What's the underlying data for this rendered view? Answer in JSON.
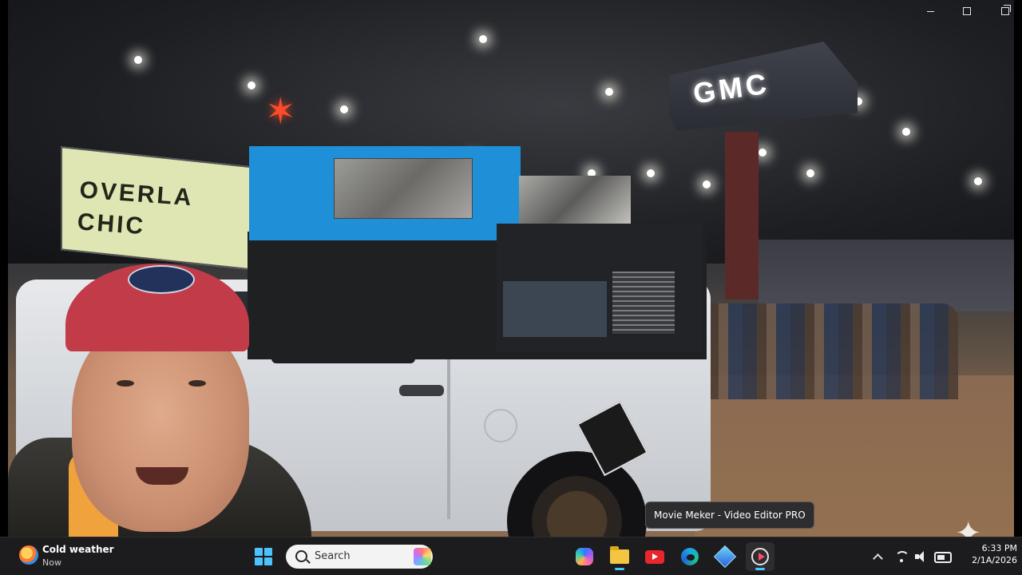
{
  "video": {
    "banner_text": "OVERLA\nCHIC",
    "sign_text": "GMC"
  },
  "tooltip": {
    "text": "Movie Meker - Video Editor PRO"
  },
  "taskbar": {
    "weather_title": "Cold weather",
    "weather_sub": "Now",
    "search_placeholder": "Search",
    "apps": [
      {
        "name": "copilot-icon"
      },
      {
        "name": "folder-icon"
      },
      {
        "name": "youtube-icon"
      },
      {
        "name": "edge-icon"
      },
      {
        "name": "diamond-icon"
      },
      {
        "name": "movie-icon"
      }
    ],
    "clock_time": "6:33 PM",
    "clock_date": "2/1A/2026",
    "accent": "#4cc2ff"
  }
}
